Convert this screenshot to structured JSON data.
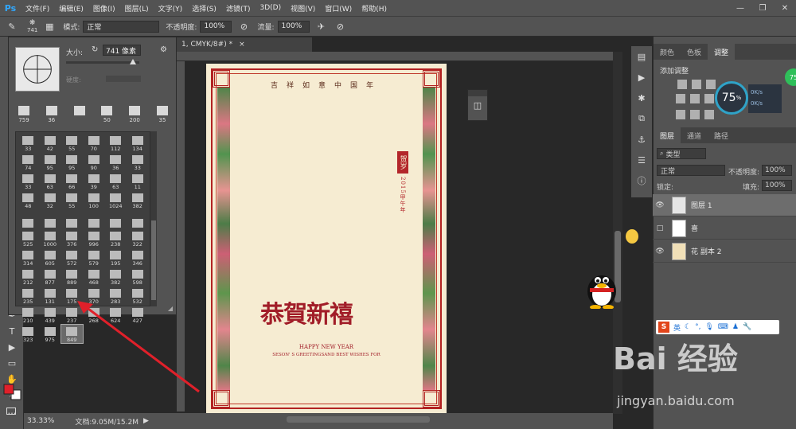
{
  "menubar": {
    "app_icon": "Ps",
    "items": [
      "文件(F)",
      "编辑(E)",
      "图像(I)",
      "图层(L)",
      "文字(Y)",
      "选择(S)",
      "滤镜(T)",
      "3D(D)",
      "视图(V)",
      "窗口(W)",
      "帮助(H)"
    ],
    "win_min": "—",
    "win_max": "❐",
    "win_close": "✕"
  },
  "options": {
    "brush_size": "741",
    "mode_label": "模式:",
    "mode_value": "正常",
    "opacity_label": "不透明度:",
    "opacity_value": "100%",
    "flow_label": "流量:",
    "flow_value": "100%"
  },
  "document": {
    "tab_title": "1, CMYK/8#) *",
    "tab_close": "×"
  },
  "brush_panel": {
    "size_label": "大小:",
    "size_value": "741 像素",
    "hardness_label": "硬度:",
    "recent": [
      "759",
      "36",
      "",
      "50",
      "200",
      "35"
    ],
    "grid": [
      "33",
      "42",
      "55",
      "70",
      "112",
      "134",
      "74",
      "95",
      "95",
      "90",
      "36",
      "33",
      "33",
      "63",
      "66",
      "39",
      "63",
      "11",
      "48",
      "32",
      "55",
      "100",
      "1024",
      "382",
      "",
      "",
      "",
      "",
      "",
      "",
      "525",
      "1000",
      "376",
      "996",
      "238",
      "322",
      "314",
      "605",
      "572",
      "579",
      "195",
      "346",
      "212",
      "877",
      "889",
      "468",
      "382",
      "598",
      "235",
      "131",
      "175",
      "370",
      "283",
      "532",
      "210",
      "439",
      "237",
      "268",
      "624",
      "427",
      "323",
      "975",
      "849"
    ]
  },
  "card": {
    "top_line": "吉祥如意中国年",
    "seal": "贺岁",
    "year": "2015甲午年",
    "greeting": "恭賀新禧",
    "sub1": "HAPPY NEW YEAR",
    "sub2": "SESON' S GREETINGSAND BEST WISHES FOR"
  },
  "status": {
    "zoom": "33.33%",
    "doc_info": "文档:9.05M/15.2M"
  },
  "right_panel": {
    "tabs_top": [
      "颜色",
      "色板",
      "调整"
    ],
    "adj_title": "添加调整",
    "speed_pct": "75",
    "speed_unit": "%",
    "speed_up": "0K/s",
    "speed_down": "0K/s",
    "badge": "75",
    "tabs_layers": [
      "图层",
      "通道",
      "路径"
    ],
    "filter_label": "类型",
    "blend": "正常",
    "opacity_label": "不透明度:",
    "opacity_value": "100%",
    "lock_label": "锁定:",
    "fill_label": "填充:",
    "fill_value": "100%",
    "layers": [
      {
        "name": "图层 1",
        "visible": true
      },
      {
        "name": "喜",
        "visible": false
      },
      {
        "name": "花 副本 2",
        "visible": true
      }
    ]
  },
  "ime": {
    "label": "英"
  },
  "watermark": {
    "brand": "Bai  经验",
    "url": "jingyan.baidu.com"
  },
  "colors": {
    "foreground": "#e0202a",
    "background": "#ffffff",
    "accent": "#31a8ff"
  }
}
